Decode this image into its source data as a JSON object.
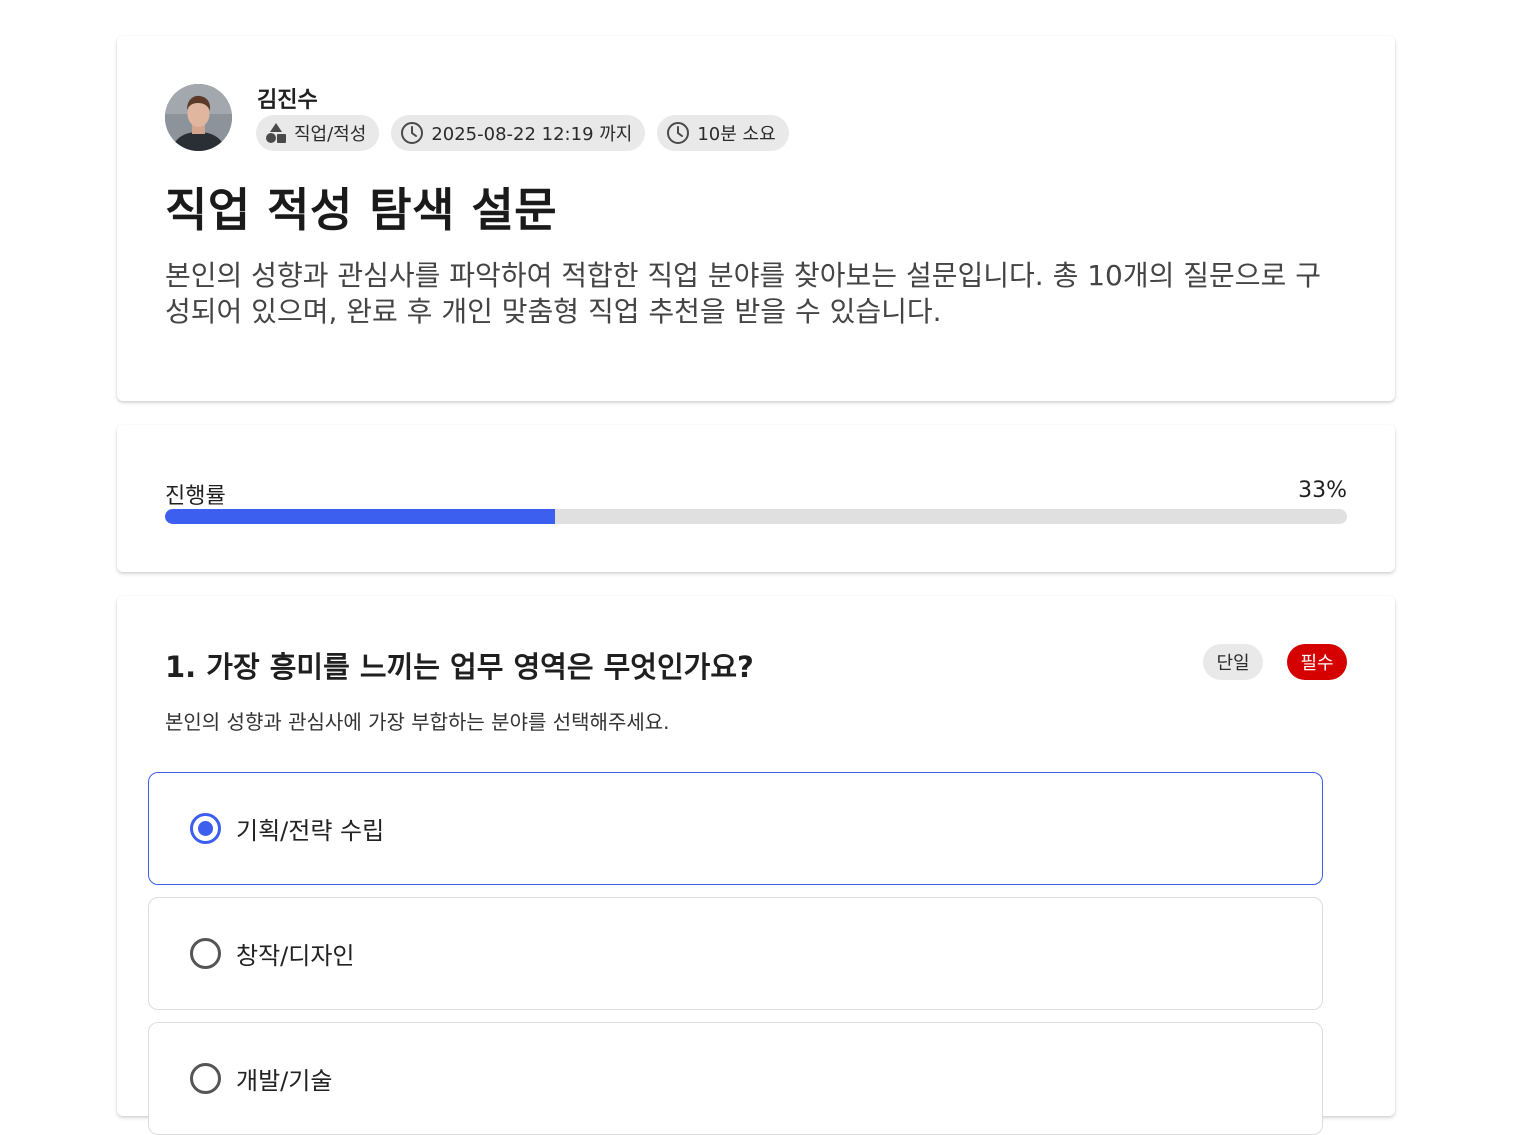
{
  "author": {
    "name": "김진수"
  },
  "meta": {
    "category": "직업/적성",
    "deadline": "2025-08-22 12:19 까지",
    "duration": "10분 소요"
  },
  "survey": {
    "title": "직업 적성 탐색 설문",
    "description": "본인의 성향과 관심사를 파악하여 적합한 직업 분야를 찾아보는 설문입니다. 총 10개의 질문으로 구성되어 있으며, 완료 후 개인 맞춤형 직업 추천을 받을 수 있습니다."
  },
  "progress": {
    "label": "진행률",
    "percent_text": "33%",
    "value": 0.33
  },
  "question": {
    "title": "1. 가장 흥미를 느끼는 업무 영역은 무엇인가요?",
    "type_badge": "단일",
    "required_badge": "필수",
    "description": "본인의 성향과 관심사에 가장 부합하는 분야를 선택해주세요.",
    "options": [
      {
        "label": "기획/전략 수립",
        "selected": true
      },
      {
        "label": "창작/디자인",
        "selected": false
      },
      {
        "label": "개발/기술",
        "selected": false
      }
    ]
  },
  "colors": {
    "accent": "#3c5ff0",
    "required": "#d50000",
    "chip_bg": "#e9e9e9"
  }
}
